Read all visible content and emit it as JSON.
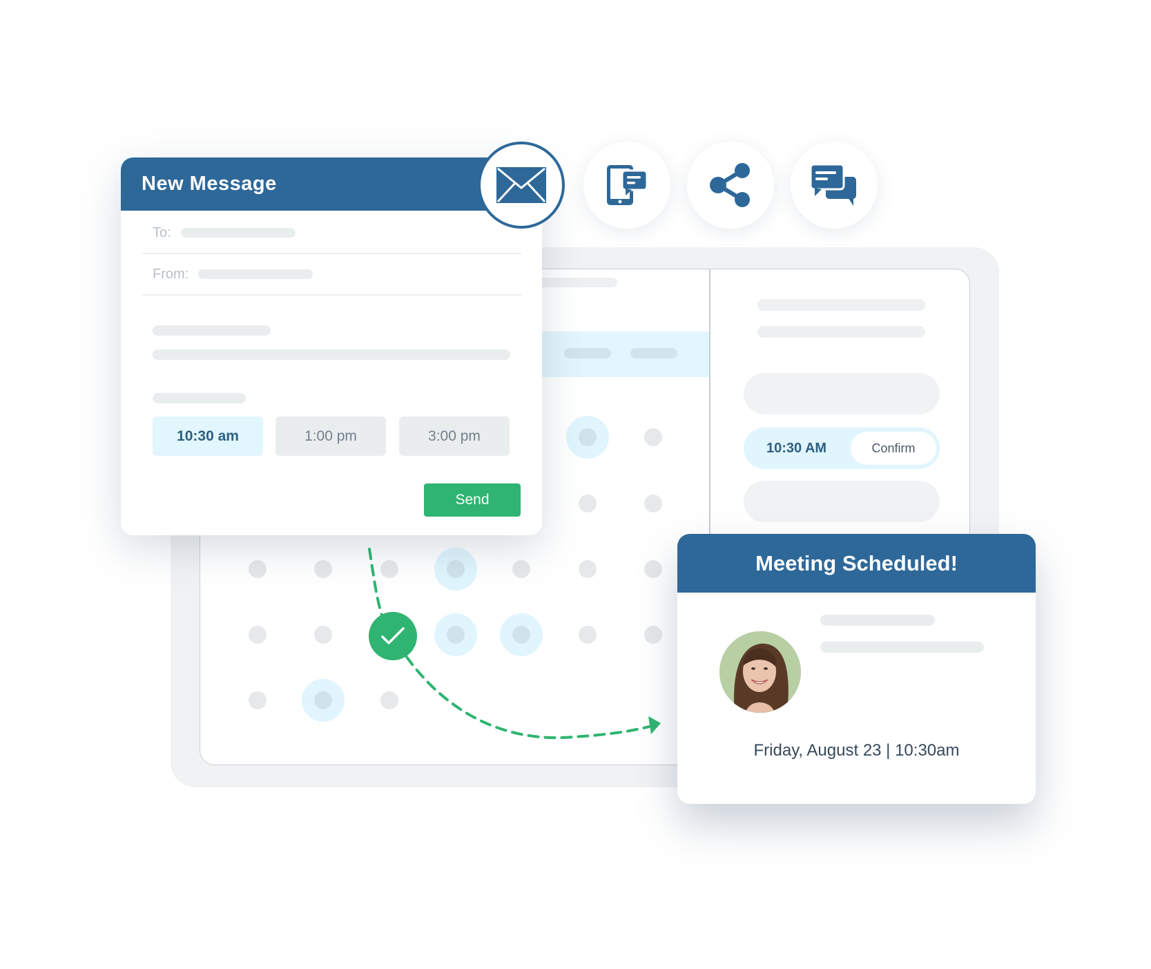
{
  "compose": {
    "title": "New Message",
    "to_label": "To:",
    "from_label": "From:",
    "time_options": [
      {
        "label": "10:30 am",
        "selected": true
      },
      {
        "label": "1:00 pm",
        "selected": false
      },
      {
        "label": "3:00 pm",
        "selected": false
      }
    ],
    "send_label": "Send",
    "icon": "mail-icon"
  },
  "channel_icons": [
    "sms-mobile-icon",
    "share-icon",
    "chat-bubbles-icon"
  ],
  "scheduler": {
    "selected_slot": {
      "time": "10:30 AM",
      "action_label": "Confirm"
    }
  },
  "meeting": {
    "title": "Meeting Scheduled!",
    "datetime": "Friday, August 23 | 10:30am",
    "avatar": "avatar-photo"
  },
  "colors": {
    "brand_blue": "#2e6899",
    "success_green": "#2fb471",
    "highlight_cyan": "#e1f6fd",
    "skeleton_gray": "#e9edee"
  }
}
